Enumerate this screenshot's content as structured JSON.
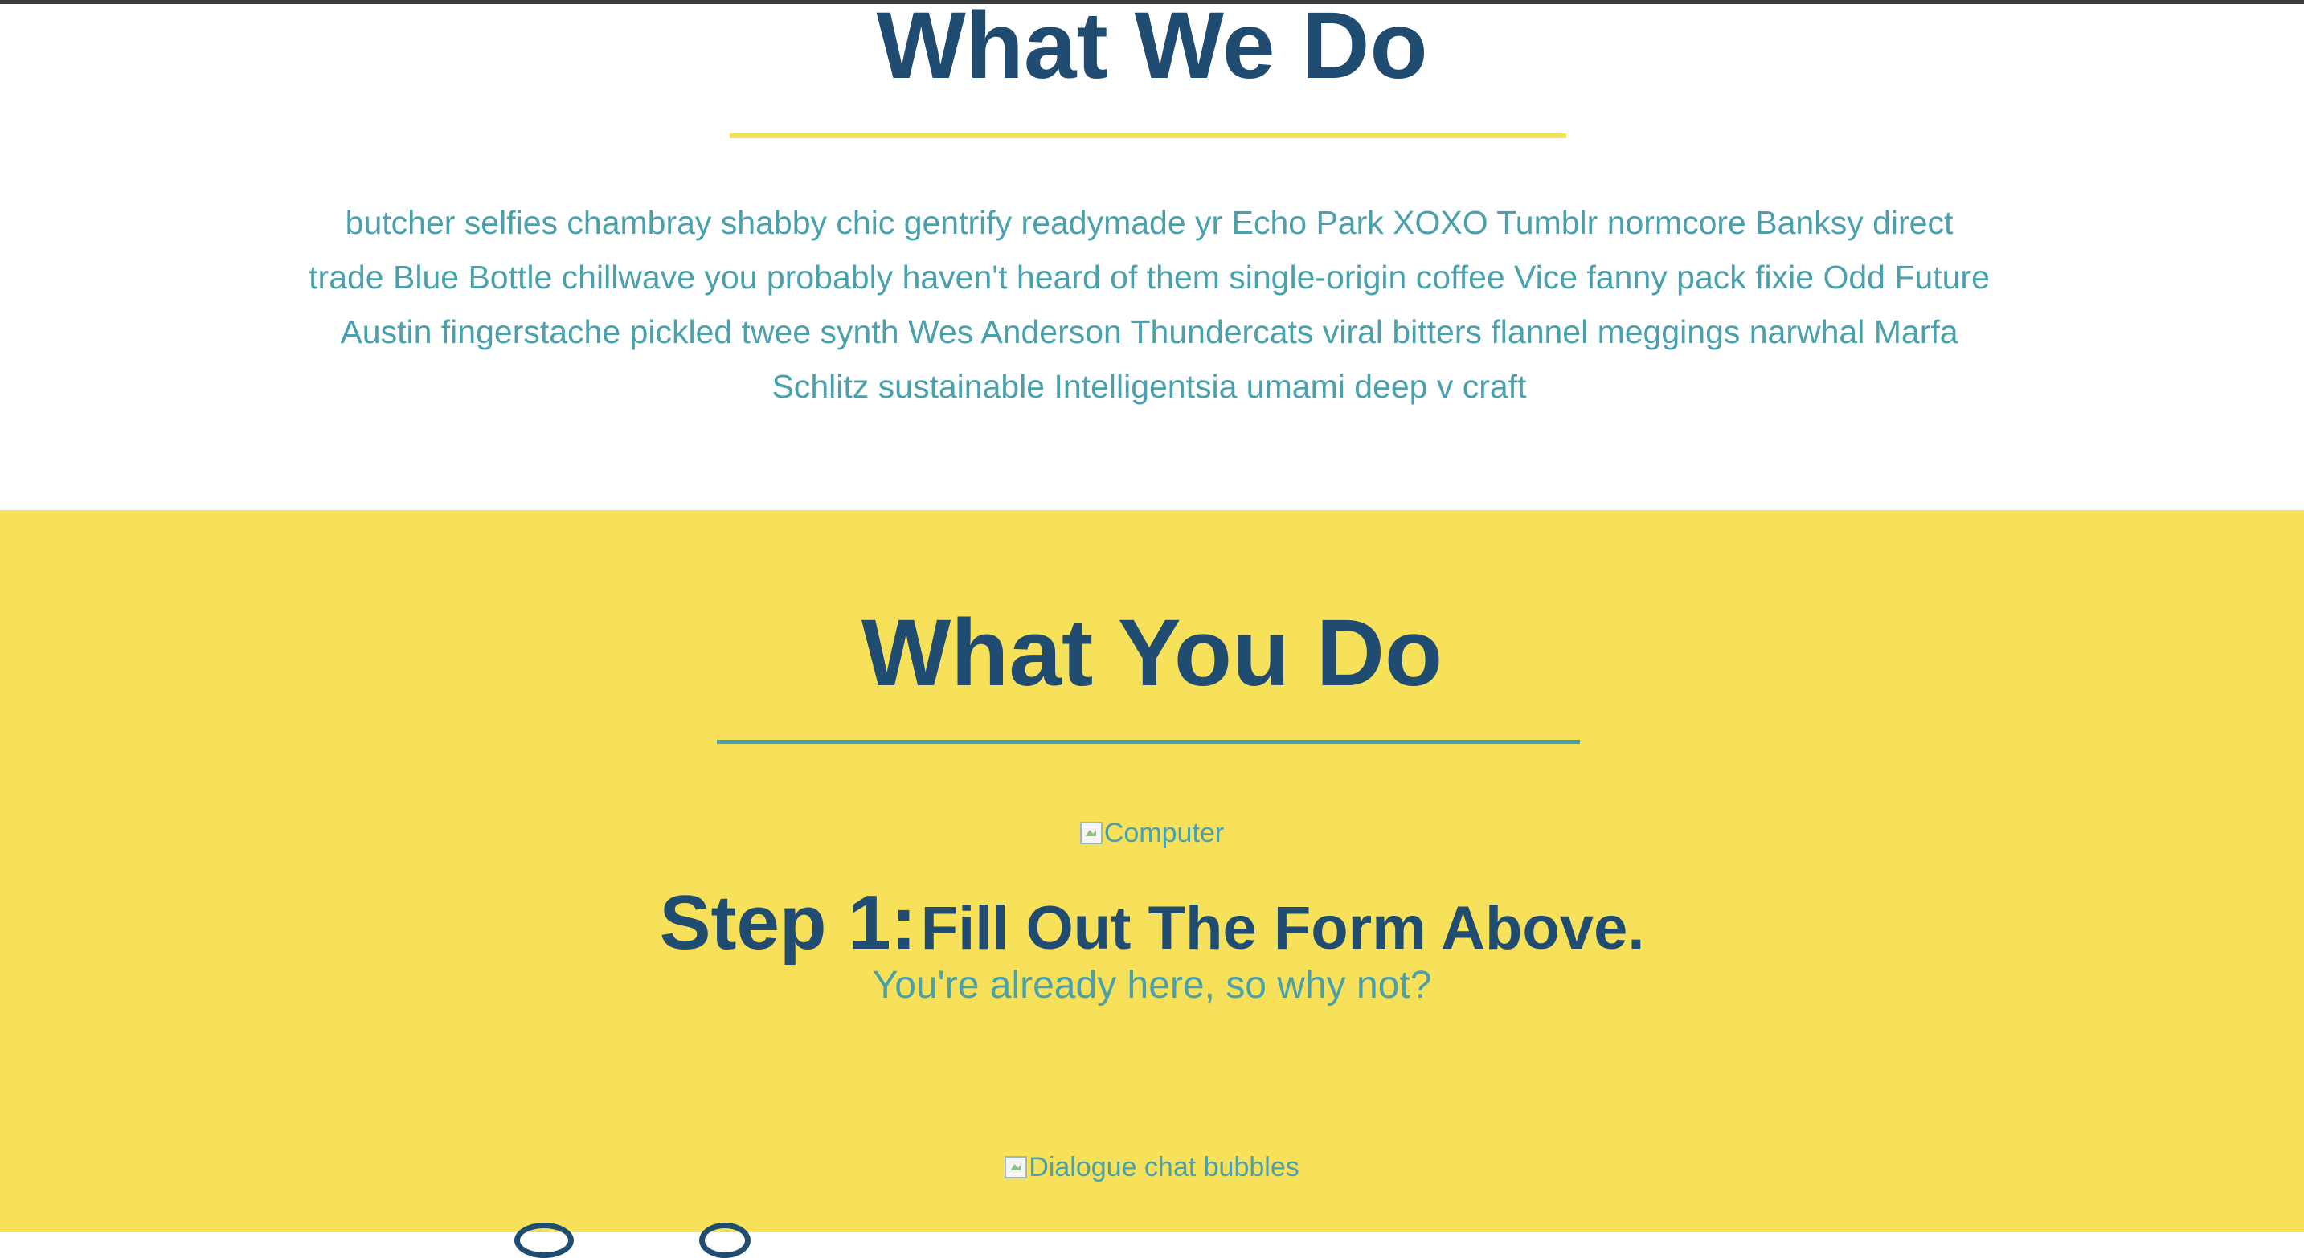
{
  "what_we_do": {
    "title": "What We Do",
    "body": "butcher selfies chambray shabby chic gentrify readymade yr Echo Park XOXO Tumblr normcore Banksy direct trade Blue Bottle chillwave you probably haven't heard of them single-origin coffee Vice fanny pack fixie Odd Future Austin fingerstache pickled twee synth Wes Anderson Thundercats viral bitters flannel meggings narwhal Marfa Schlitz sustainable Intelligentsia umami deep v craft"
  },
  "what_you_do": {
    "title": "What You Do",
    "step1": {
      "image_alt": "Computer",
      "number": "Step 1:",
      "text": "Fill Out The Form Above.",
      "subtitle": "You're already here, so why not?"
    },
    "step2": {
      "image_alt": "Dialogue chat bubbles"
    }
  },
  "colors": {
    "navy": "#1f4c70",
    "teal": "#4aa1ab",
    "yellow": "#f7e05a"
  }
}
